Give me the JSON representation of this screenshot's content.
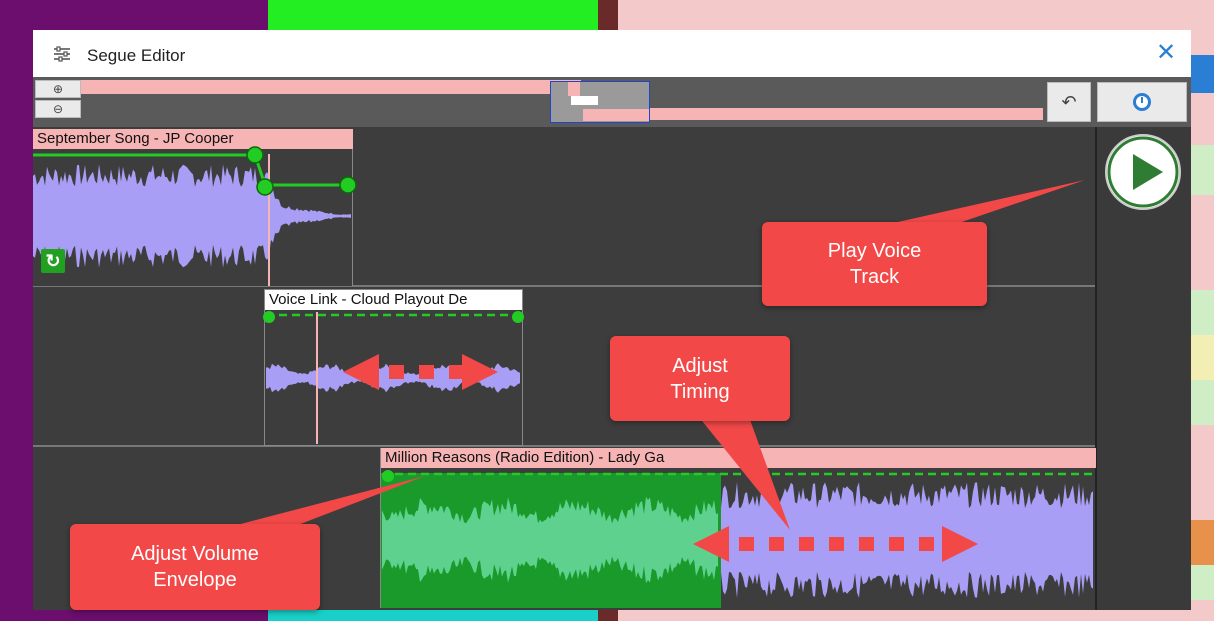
{
  "dialog": {
    "title": "Segue Editor",
    "close_label": "✕"
  },
  "toolbar": {
    "zoom_in_label": "⊕",
    "zoom_out_label": "⊖",
    "undo_label": "↶",
    "timer_label": "◷"
  },
  "tracks": [
    {
      "label": "September Song - JP Cooper",
      "color": "#a89ef5"
    },
    {
      "label": "Voice Link - Cloud Playout De",
      "color": "#a89ef5"
    },
    {
      "label": "Million Reasons (Radio Edition) - Lady Ga",
      "color": "#a89ef5"
    }
  ],
  "callouts": {
    "play": "Play Voice Track",
    "timing": "Adjust Timing",
    "volume": "Adjust Volume Envelope"
  },
  "colors": {
    "track_header": "#f6b4b4",
    "waveform": "#a89ef5",
    "waveform_green": "#5fd18f",
    "envelope": "#22cc22",
    "callout": "#f24848",
    "play_button": "#2e7d32"
  }
}
